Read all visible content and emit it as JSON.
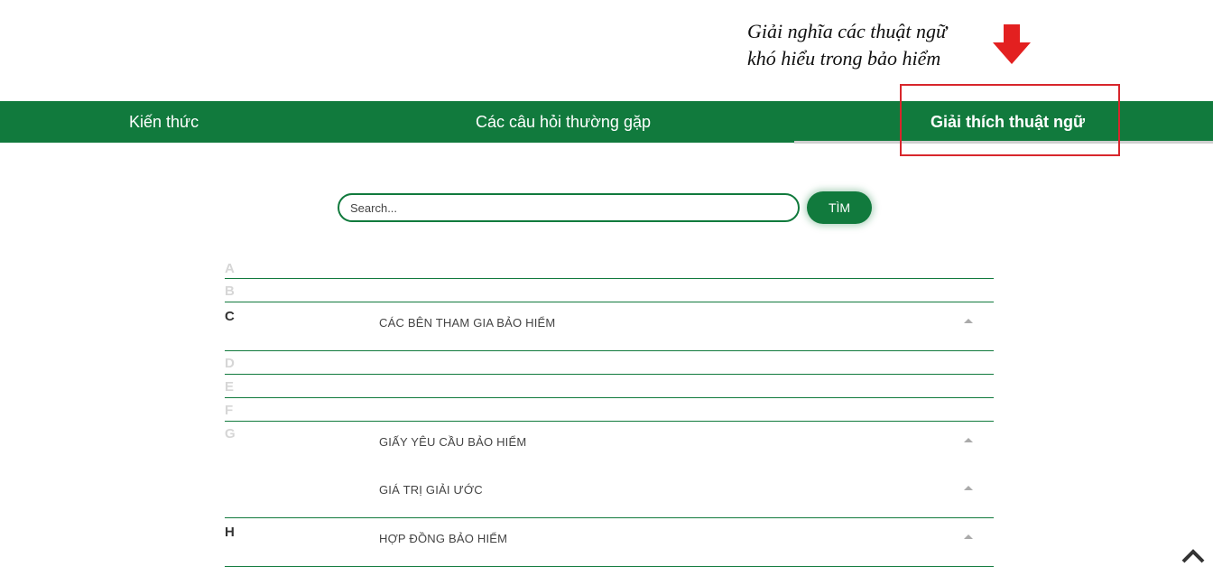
{
  "annotation": {
    "line1": "Giải nghĩa các thuật ngữ",
    "line2": "khó hiểu trong bảo hiểm",
    "color": "#d8262c"
  },
  "nav": {
    "items": [
      {
        "label": "Kiến thức"
      },
      {
        "label": "Các câu hỏi thường gặp"
      },
      {
        "label": "Giải thích thuật ngữ",
        "active": true
      }
    ],
    "background": "#117a3d"
  },
  "search": {
    "placeholder": "Search...",
    "button_label": "TÌM"
  },
  "glossary": {
    "letters": [
      {
        "letter": "A",
        "entries": []
      },
      {
        "letter": "B",
        "entries": []
      },
      {
        "letter": "C",
        "entries": [
          "CÁC BÊN THAM GIA BẢO HIỂM"
        ]
      },
      {
        "letter": "D",
        "entries": []
      },
      {
        "letter": "E",
        "entries": []
      },
      {
        "letter": "F",
        "entries": []
      },
      {
        "letter": "G",
        "entries": [
          "GIẤY YÊU CẦU BẢO HIỂM",
          "GIÁ TRỊ GIẢI ƯỚC"
        ]
      },
      {
        "letter": "H",
        "entries": [
          "HỢP ĐỒNG BẢO HIỂM"
        ]
      }
    ]
  },
  "icons": {
    "arrow": "arrow-down-icon",
    "caret": "chevron-up-icon",
    "scroll_top": "scroll-top-icon"
  }
}
